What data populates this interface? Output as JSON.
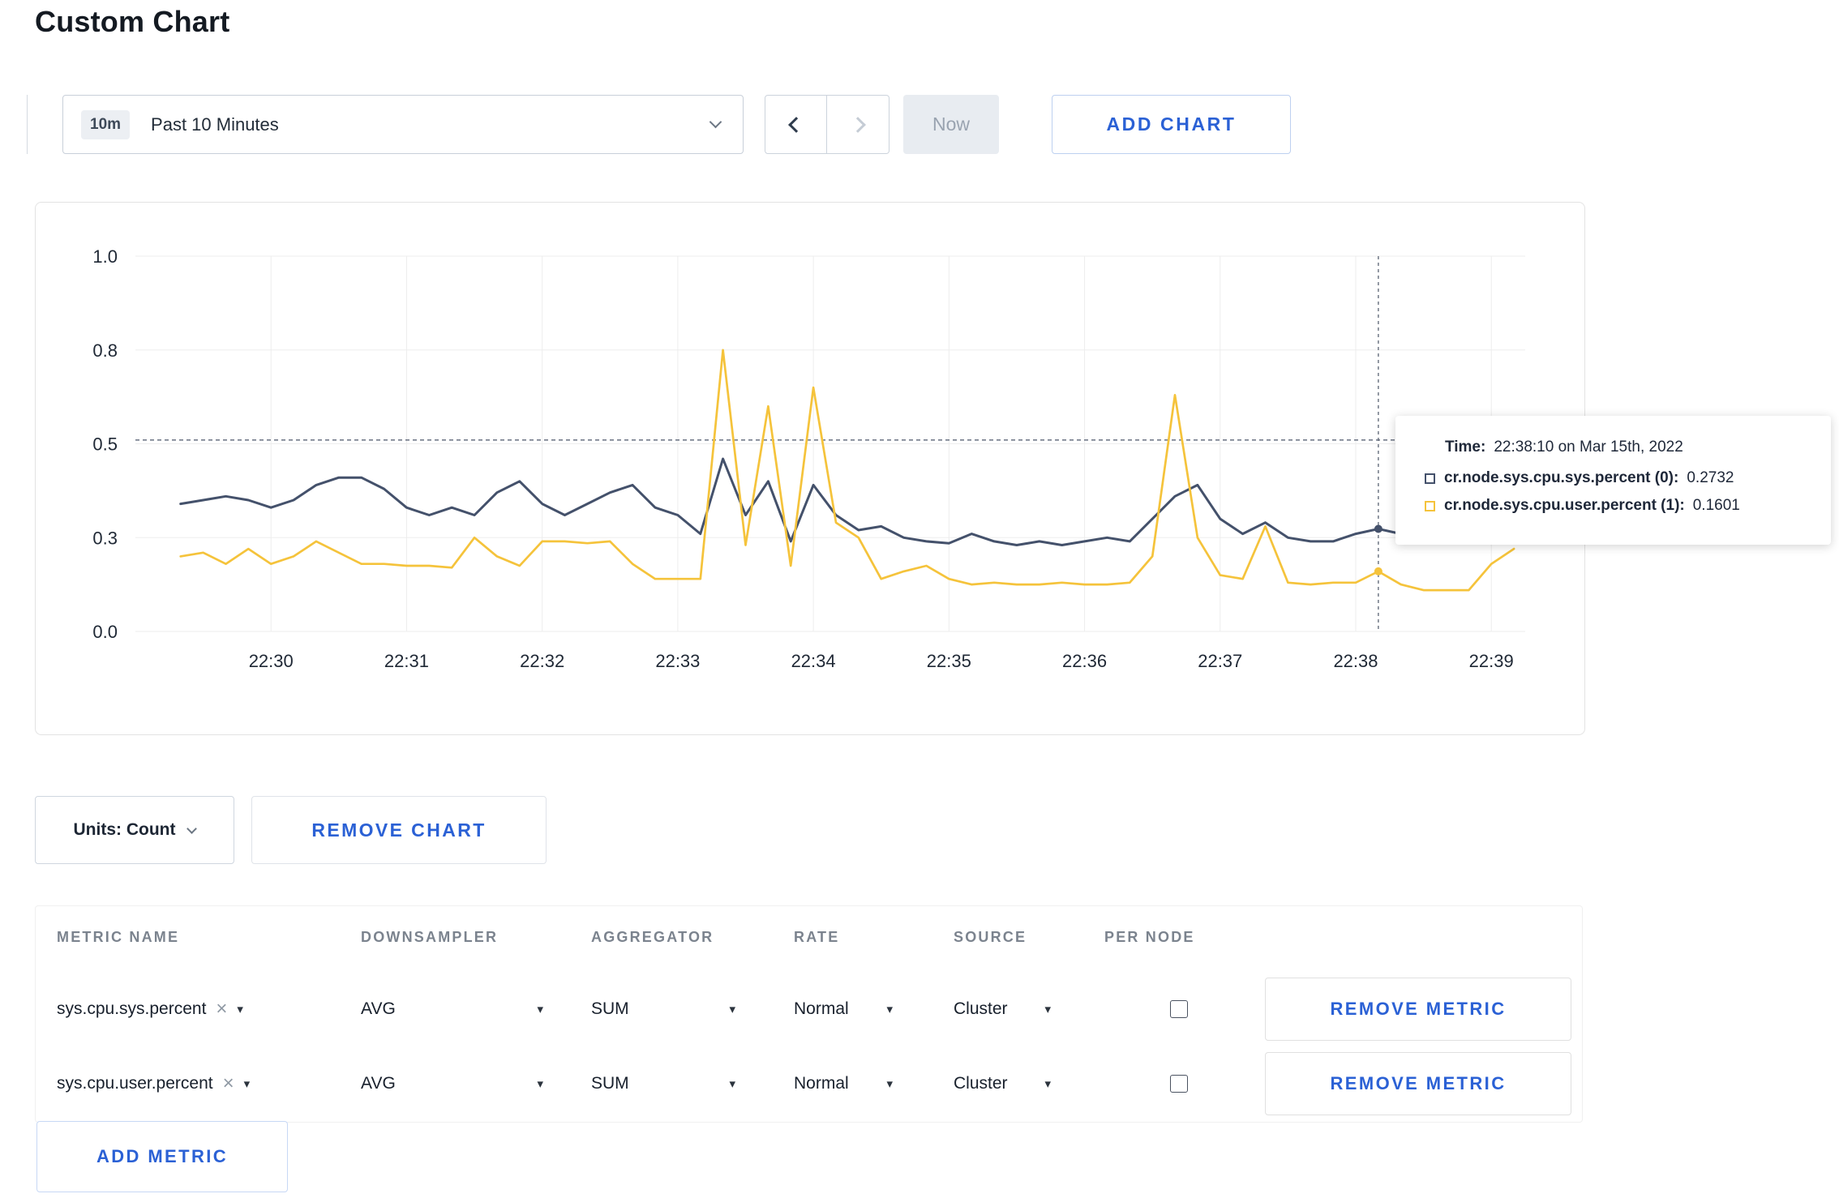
{
  "page": {
    "title": "Custom Chart"
  },
  "toolbar": {
    "time_range": {
      "badge": "10m",
      "label": "Past 10 Minutes"
    },
    "now_label": "Now",
    "add_chart_label": "ADD CHART"
  },
  "accent_color": "#2b61d5",
  "icons": {
    "caret": "▾",
    "close": "×"
  },
  "tooltip": {
    "time_label": "Time:",
    "time_value": "22:38:10 on Mar 15th, 2022",
    "rows": [
      {
        "label": "cr.node.sys.cpu.sys.percent (0):",
        "value": "0.2732"
      },
      {
        "label": "cr.node.sys.cpu.user.percent (1):",
        "value": "0.1601"
      }
    ]
  },
  "chart_controls": {
    "units_label": "Units: Count",
    "remove_chart_label": "REMOVE CHART"
  },
  "metrics_table": {
    "headers": [
      "METRIC NAME",
      "DOWNSAMPLER",
      "AGGREGATOR",
      "RATE",
      "SOURCE",
      "PER NODE"
    ],
    "rows": [
      {
        "metric": "sys.cpu.sys.percent",
        "downsampler": "AVG",
        "aggregator": "SUM",
        "rate": "Normal",
        "source": "Cluster",
        "per_node_checked": false,
        "remove_label": "REMOVE METRIC"
      },
      {
        "metric": "sys.cpu.user.percent",
        "downsampler": "AVG",
        "aggregator": "SUM",
        "rate": "Normal",
        "source": "Cluster",
        "per_node_checked": false,
        "remove_label": "REMOVE METRIC"
      }
    ],
    "add_metric_label": "ADD METRIC"
  },
  "chart_data": {
    "type": "line",
    "title": "",
    "xlabel": "",
    "ylabel": "",
    "grid": true,
    "legend": "none",
    "x_unit": "minutes after 22:29",
    "x_domain": [
      0,
      10.25
    ],
    "y_domain": [
      0,
      1
    ],
    "x_ticks": [
      {
        "pos": 1,
        "label": "22:30"
      },
      {
        "pos": 2,
        "label": "22:31"
      },
      {
        "pos": 3,
        "label": "22:32"
      },
      {
        "pos": 4,
        "label": "22:33"
      },
      {
        "pos": 5,
        "label": "22:34"
      },
      {
        "pos": 6,
        "label": "22:35"
      },
      {
        "pos": 7,
        "label": "22:36"
      },
      {
        "pos": 8,
        "label": "22:37"
      },
      {
        "pos": 9,
        "label": "22:38"
      },
      {
        "pos": 10,
        "label": "22:39"
      }
    ],
    "y_ticks": [
      {
        "pos": 0,
        "label": "0.0"
      },
      {
        "pos": 0.25,
        "label": "0.3"
      },
      {
        "pos": 0.5,
        "label": "0.5"
      },
      {
        "pos": 0.75,
        "label": "0.8"
      },
      {
        "pos": 1,
        "label": "1.0"
      }
    ],
    "guide_value": 0.51,
    "crosshair": {
      "t": 9.167,
      "time": "22:38:10 on Mar 15th, 2022",
      "points": [
        {
          "series": 0,
          "value": 0.2732
        },
        {
          "series": 1,
          "value": 0.1601
        }
      ]
    },
    "series": [
      {
        "name": "cr.node.sys.cpu.sys.percent",
        "color": "#44516b",
        "start": 0.3333,
        "step": 0.16667,
        "values": [
          0.34,
          0.35,
          0.36,
          0.35,
          0.33,
          0.35,
          0.39,
          0.41,
          0.41,
          0.38,
          0.33,
          0.31,
          0.33,
          0.31,
          0.37,
          0.4,
          0.34,
          0.31,
          0.34,
          0.37,
          0.39,
          0.33,
          0.31,
          0.26,
          0.46,
          0.31,
          0.4,
          0.24,
          0.39,
          0.31,
          0.27,
          0.28,
          0.25,
          0.24,
          0.235,
          0.26,
          0.24,
          0.23,
          0.24,
          0.23,
          0.24,
          0.25,
          0.24,
          0.3,
          0.36,
          0.39,
          0.3,
          0.26,
          0.29,
          0.25,
          0.24,
          0.24,
          0.26,
          0.2732,
          0.26,
          0.25,
          0.26,
          0.27,
          0.26,
          0.26
        ]
      },
      {
        "name": "cr.node.sys.cpu.user.percent",
        "color": "#f5c33b",
        "start": 0.3333,
        "step": 0.16667,
        "values": [
          0.2,
          0.21,
          0.18,
          0.22,
          0.18,
          0.2,
          0.24,
          0.21,
          0.18,
          0.18,
          0.175,
          0.175,
          0.17,
          0.25,
          0.2,
          0.175,
          0.24,
          0.24,
          0.235,
          0.24,
          0.18,
          0.14,
          0.14,
          0.14,
          0.75,
          0.23,
          0.6,
          0.175,
          0.65,
          0.29,
          0.25,
          0.14,
          0.16,
          0.175,
          0.14,
          0.125,
          0.13,
          0.125,
          0.125,
          0.13,
          0.125,
          0.125,
          0.13,
          0.2,
          0.63,
          0.25,
          0.15,
          0.14,
          0.28,
          0.13,
          0.125,
          0.13,
          0.13,
          0.1601,
          0.125,
          0.11,
          0.11,
          0.11,
          0.18,
          0.22
        ]
      }
    ]
  }
}
